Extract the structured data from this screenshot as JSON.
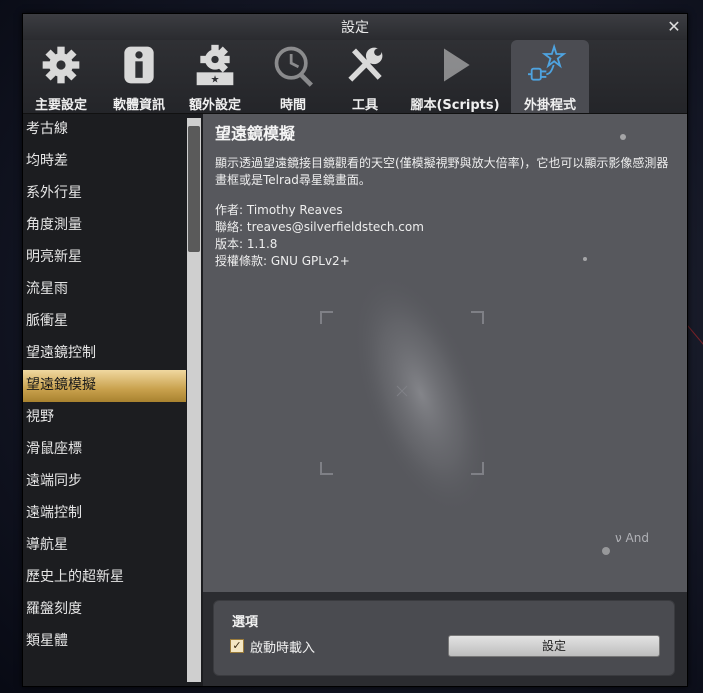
{
  "window": {
    "title": "設定",
    "close_icon": "close-icon"
  },
  "tabs": [
    {
      "label": "主要設定",
      "icon": "gear-icon"
    },
    {
      "label": "軟體資訊",
      "icon": "info-icon"
    },
    {
      "label": "額外設定",
      "icon": "gear-stars-icon"
    },
    {
      "label": "時間",
      "icon": "clock-icon"
    },
    {
      "label": "工具",
      "icon": "tools-icon"
    },
    {
      "label": "腳本(Scripts)",
      "icon": "play-icon"
    },
    {
      "label": "外掛程式",
      "icon": "plugin-icon",
      "active": true
    }
  ],
  "sidebar": {
    "items": [
      {
        "label": "考古線"
      },
      {
        "label": "均時差"
      },
      {
        "label": "系外行星"
      },
      {
        "label": "角度測量"
      },
      {
        "label": "明亮新星"
      },
      {
        "label": "流星雨"
      },
      {
        "label": "脈衝星"
      },
      {
        "label": "望遠鏡控制"
      },
      {
        "label": "望遠鏡模擬",
        "active": true
      },
      {
        "label": "視野"
      },
      {
        "label": "滑鼠座標"
      },
      {
        "label": "遠端同步"
      },
      {
        "label": "遠端控制"
      },
      {
        "label": "導航星"
      },
      {
        "label": "歷史上的超新星"
      },
      {
        "label": "羅盤刻度"
      },
      {
        "label": "類星體"
      }
    ]
  },
  "content": {
    "title": "望遠鏡模擬",
    "description": "顯示透過望遠鏡接目鏡觀看的天空(僅模擬視野與放大倍率)，它也可以顯示影像感測器畫框或是Telrad尋星鏡畫面。",
    "author": "作者: Timothy Reaves",
    "contact": "聯絡: treaves@silverfieldstech.com",
    "version": "版本: 1.1.8",
    "license": "授權條款: GNU GPLv2+"
  },
  "options": {
    "title": "選項",
    "load_on_startup_label": "啟動時載入",
    "load_on_startup_checked": true,
    "configure_button_label": "設定"
  },
  "sky": {
    "star_label": "ν And"
  },
  "colors": {
    "active_tab": "#4b4c52",
    "active_item": "#c9a14d",
    "accent_plugin_icon": "#4ea3e0"
  }
}
